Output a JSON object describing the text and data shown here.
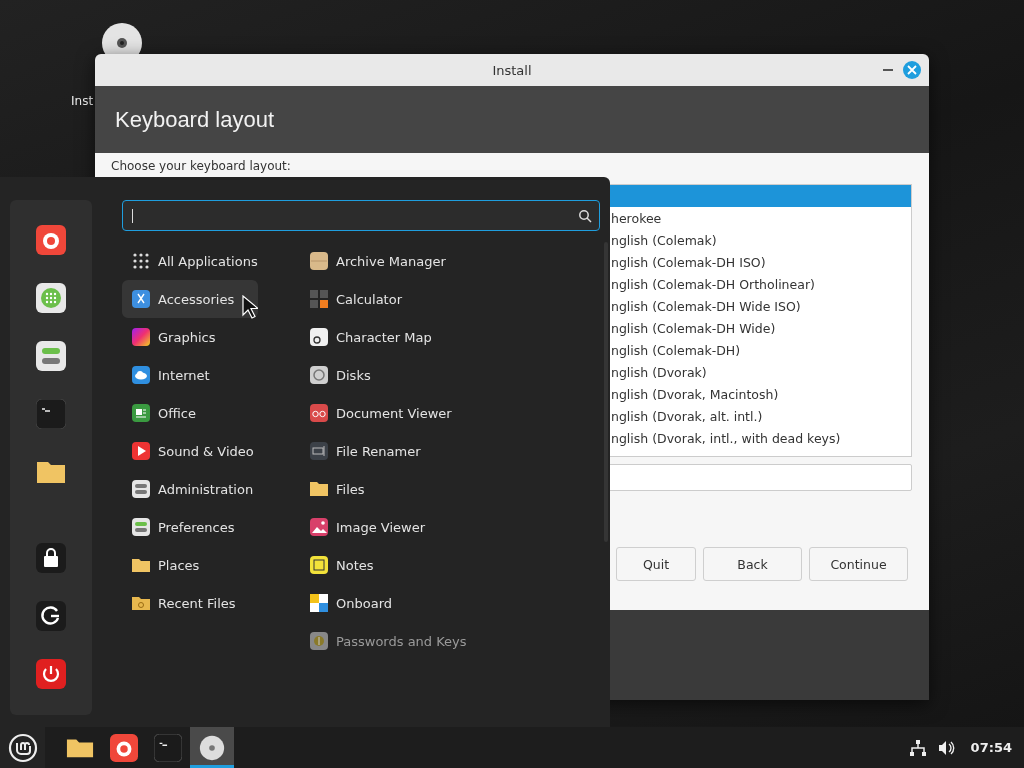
{
  "desktop": {
    "icon_label": "Inst"
  },
  "window": {
    "title": "Install",
    "heading": "Keyboard layout",
    "prompt": "Choose your keyboard layout:",
    "variants": [
      {
        "selected": true
      },
      {
        "label": "herokee",
        "selected": false
      },
      {
        "label": "nglish (Colemak)",
        "selected": false
      },
      {
        "label": "nglish (Colemak-DH ISO)",
        "selected": false
      },
      {
        "label": "nglish (Colemak-DH Ortholinear)",
        "selected": false
      },
      {
        "label": "nglish (Colemak-DH Wide ISO)",
        "selected": false
      },
      {
        "label": "nglish (Colemak-DH Wide)",
        "selected": false
      },
      {
        "label": "nglish (Colemak-DH)",
        "selected": false
      },
      {
        "label": "nglish (Dvorak)",
        "selected": false
      },
      {
        "label": "nglish (Dvorak, Macintosh)",
        "selected": false
      },
      {
        "label": "nglish (Dvorak, alt. intl.)",
        "selected": false
      },
      {
        "label": "nglish (Dvorak, intl., with dead keys)",
        "selected": false
      }
    ],
    "buttons": [
      "Quit",
      "Back",
      "Continue"
    ]
  },
  "menu": {
    "search": {
      "focused": true
    },
    "categories": [
      {
        "label": "All Applications",
        "selected": false
      },
      {
        "label": "Accessories",
        "selected": true
      },
      {
        "label": "Graphics",
        "selected": false
      },
      {
        "label": "Internet",
        "selected": false
      },
      {
        "label": "Office",
        "selected": false
      },
      {
        "label": "Sound & Video",
        "selected": false
      },
      {
        "label": "Administration",
        "selected": false
      },
      {
        "label": "Preferences",
        "selected": false
      },
      {
        "label": "Places",
        "selected": false
      },
      {
        "label": "Recent Files",
        "selected": false
      }
    ],
    "apps": [
      {
        "label": "Archive Manager",
        "dimmed": false
      },
      {
        "label": "Calculator",
        "dimmed": false
      },
      {
        "label": "Character Map",
        "dimmed": false
      },
      {
        "label": "Disks",
        "dimmed": false
      },
      {
        "label": "Document Viewer",
        "dimmed": false
      },
      {
        "label": "File Renamer",
        "dimmed": false
      },
      {
        "label": "Files",
        "dimmed": false
      },
      {
        "label": "Image Viewer",
        "dimmed": false
      },
      {
        "label": "Notes",
        "dimmed": false
      },
      {
        "label": "Onboard",
        "dimmed": false
      },
      {
        "label": "Passwords and Keys",
        "dimmed": true
      }
    ]
  },
  "taskbar": {
    "items": [
      {
        "active": false
      },
      {
        "active": false
      },
      {
        "active": false
      },
      {
        "active": true
      }
    ],
    "clock": "07:54"
  }
}
